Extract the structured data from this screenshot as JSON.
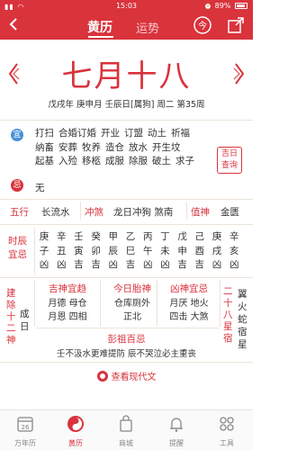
{
  "status": {
    "time": "15:03",
    "battery": "89%"
  },
  "header": {
    "tab_active": "黄历",
    "tab_other": "运势"
  },
  "date": {
    "lunar": "七月十八",
    "ganzhi": "戊戌年  庚申月  壬辰日[属狗]  周二  第35周"
  },
  "yi": {
    "badge": "宜",
    "items": [
      "打扫",
      "合婚订婚",
      "开业",
      "订盟",
      "动土",
      "祈福",
      "纳畜",
      "安葬",
      "牧养",
      "造仓",
      "放水",
      "开生坟",
      "起基",
      "入殓",
      "移柩",
      "成服",
      "除服",
      "破土",
      "求子"
    ]
  },
  "jixiong": {
    "line1": "吉日",
    "line2": "查询"
  },
  "ji": {
    "badge": "忌",
    "text": "无"
  },
  "wuxing": {
    "label1": "五行",
    "value1": "长流水",
    "label2": "冲煞",
    "value2": "龙日冲狗  煞南",
    "label3": "值神",
    "value3": "金匮"
  },
  "hours": {
    "title": [
      "时",
      "辰",
      "宜",
      "忌"
    ],
    "columns": [
      [
        "庚",
        "子",
        "凶"
      ],
      [
        "辛",
        "丑",
        "凶"
      ],
      [
        "壬",
        "寅",
        "吉"
      ],
      [
        "癸",
        "卯",
        "吉"
      ],
      [
        "甲",
        "辰",
        "凶"
      ],
      [
        "乙",
        "巳",
        "吉"
      ],
      [
        "丙",
        "午",
        "凶"
      ],
      [
        "丁",
        "未",
        "凶"
      ],
      [
        "戊",
        "申",
        "吉"
      ],
      [
        "己",
        "酉",
        "吉"
      ],
      [
        "庚",
        "戌",
        "凶"
      ],
      [
        "辛",
        "亥",
        "凶"
      ]
    ]
  },
  "jianchu": {
    "title": [
      "建",
      "除",
      "十",
      "二",
      "神"
    ],
    "value": [
      "成",
      "日"
    ]
  },
  "jishen": {
    "title": "吉神宜趋",
    "line1": "月德  母仓",
    "line2": "月恩  四相"
  },
  "taishen": {
    "title": "今日胎神",
    "line1": "仓库厕外",
    "line2": "正北"
  },
  "xiongshen": {
    "title": "凶神宜忌",
    "line1": "月厌  地火",
    "line2": "四击  大煞"
  },
  "xiu": {
    "title": [
      "二",
      "十",
      "八",
      "星",
      "宿"
    ],
    "value": [
      "翼",
      "火",
      "蛇",
      "宿",
      "星"
    ]
  },
  "pengzu": {
    "title": "彭祖百忌",
    "text": "壬不汲水更难提防  辰不哭泣必主重丧"
  },
  "view_modern": "查看现代文",
  "tabbar": {
    "tabs": [
      {
        "label": "万年历",
        "icon_text": "26"
      },
      {
        "label": "黄历"
      },
      {
        "label": "商城"
      },
      {
        "label": "提醒"
      },
      {
        "label": "工具"
      }
    ]
  },
  "colors": {
    "brand": "#d9333c",
    "bg": "#ffffff",
    "text": "#333333"
  }
}
